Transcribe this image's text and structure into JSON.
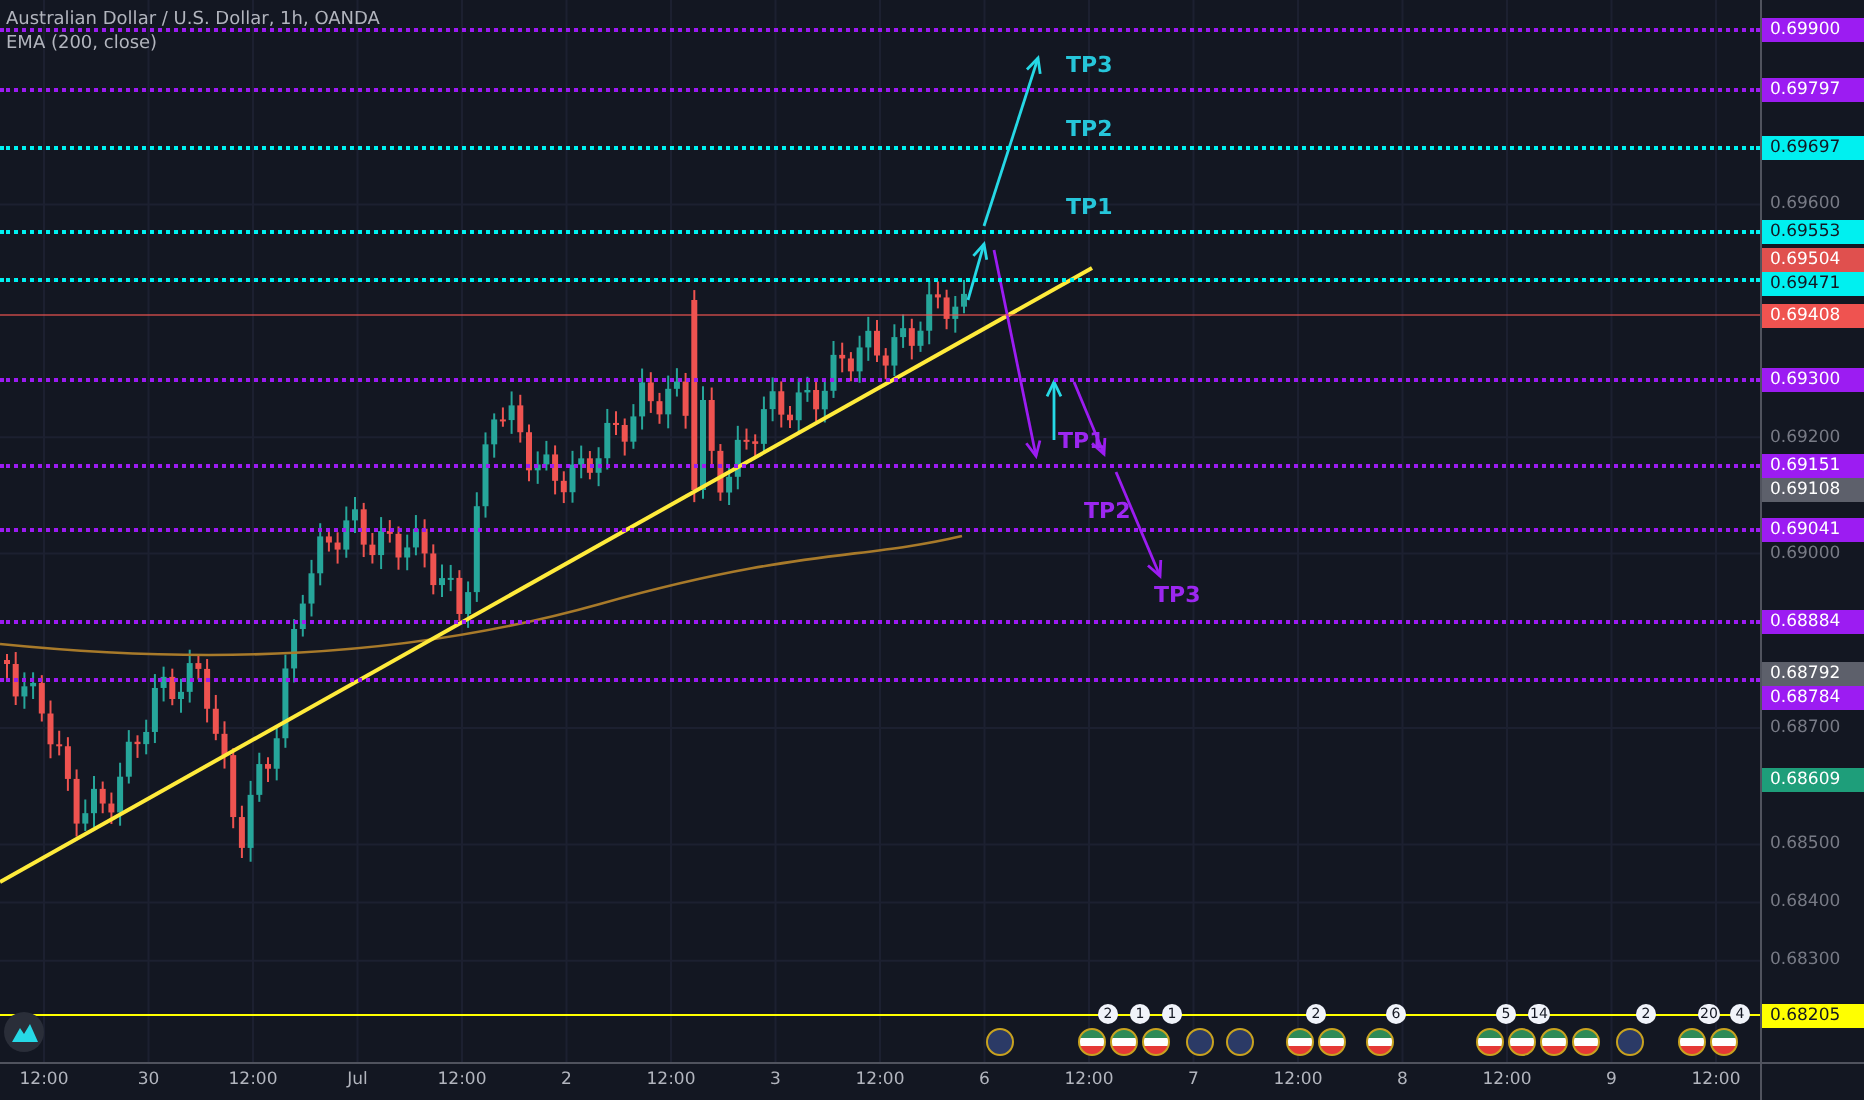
{
  "title": "Australian Dollar / U.S. Dollar, 1h, OANDA",
  "indicator": "EMA (200, close)",
  "annotations": [
    {
      "text": "TP3",
      "color": "#26c6da"
    },
    {
      "text": "TP2",
      "color": "#26c6da"
    },
    {
      "text": "TP1",
      "color": "#26c6da"
    },
    {
      "text": "TP1",
      "color": "#9c27f0"
    },
    {
      "text": "TP2",
      "color": "#9c27f0"
    },
    {
      "text": "TP3",
      "color": "#9c27f0"
    }
  ],
  "price_axis": [
    {
      "kind": "badge",
      "text": "0.69900",
      "color": "#9c1cf2",
      "line": true,
      "dotted": true
    },
    {
      "kind": "badge",
      "text": "0.69797",
      "color": "#9c1cf2",
      "line": true,
      "dotted": true
    },
    {
      "kind": "badge",
      "text": "0.69697",
      "color": "#00f0f0",
      "line": true,
      "dotted": true
    },
    {
      "kind": "tick",
      "text": "0.69600"
    },
    {
      "kind": "badge",
      "text": "0.69553",
      "color": "#00f0f0",
      "line": true,
      "dotted": true
    },
    {
      "kind": "badge",
      "text": "0.69504",
      "color": "#e0504e"
    },
    {
      "kind": "badge",
      "text": "0.69471",
      "color": "#00f0f0",
      "line": true,
      "dotted": true
    },
    {
      "kind": "badge",
      "text": "0.69408",
      "color": "#ef5350",
      "line": true,
      "dotted": false
    },
    {
      "kind": "badge",
      "text": "0.69300",
      "color": "#9c1cf2",
      "line": true,
      "dotted": true
    },
    {
      "kind": "tick",
      "text": "0.69200"
    },
    {
      "kind": "badge",
      "text": "0.69151",
      "color": "#9c1cf2",
      "line": true,
      "dotted": true
    },
    {
      "kind": "badge",
      "text": "0.69108",
      "color": "#5d606b"
    },
    {
      "kind": "badge",
      "text": "0.69041",
      "color": "#9c1cf2",
      "line": true,
      "dotted": true
    },
    {
      "kind": "tick",
      "text": "0.69000"
    },
    {
      "kind": "badge",
      "text": "0.68884",
      "color": "#9c1cf2",
      "line": true,
      "dotted": true
    },
    {
      "kind": "badge",
      "text": "0.68792",
      "color": "#5d606b"
    },
    {
      "kind": "badge",
      "text": "0.68784",
      "color": "#9c1cf2",
      "line": true,
      "dotted": true
    },
    {
      "kind": "tick",
      "text": "0.68700"
    },
    {
      "kind": "badge",
      "text": "0.68609",
      "color": "#1e9e7a"
    },
    {
      "kind": "tick",
      "text": "0.68500"
    },
    {
      "kind": "tick",
      "text": "0.68400"
    },
    {
      "kind": "tick",
      "text": "0.68300"
    },
    {
      "kind": "badge",
      "text": "0.68205",
      "color": "#ffff00",
      "line": true,
      "dotted": false
    }
  ],
  "time_axis": [
    "12:00",
    "30",
    "12:00",
    "Jul",
    "12:00",
    "2",
    "12:00",
    "3",
    "12:00",
    "6",
    "12:00",
    "7",
    "12:00",
    "8",
    "12:00",
    "9",
    "12:00"
  ],
  "events": [
    {
      "kind": "navy"
    },
    {
      "kind": "tricolor",
      "count": "2"
    },
    {
      "kind": "tricolor",
      "count": "1"
    },
    {
      "kind": "tricolor",
      "count": "1"
    },
    {
      "kind": "navy"
    },
    {
      "kind": "navy"
    },
    {
      "kind": "tricolor",
      "count": "2"
    },
    {
      "kind": "tricolor"
    },
    {
      "kind": "tricolor",
      "count": "6"
    },
    {
      "kind": "tricolor",
      "count": "5"
    },
    {
      "kind": "tricolor",
      "count": "14"
    },
    {
      "kind": "tricolor"
    },
    {
      "kind": "tricolor"
    },
    {
      "kind": "navy",
      "count": "2"
    },
    {
      "kind": "tricolor",
      "count": "20"
    },
    {
      "kind": "tricolor",
      "count": "4"
    }
  ]
}
